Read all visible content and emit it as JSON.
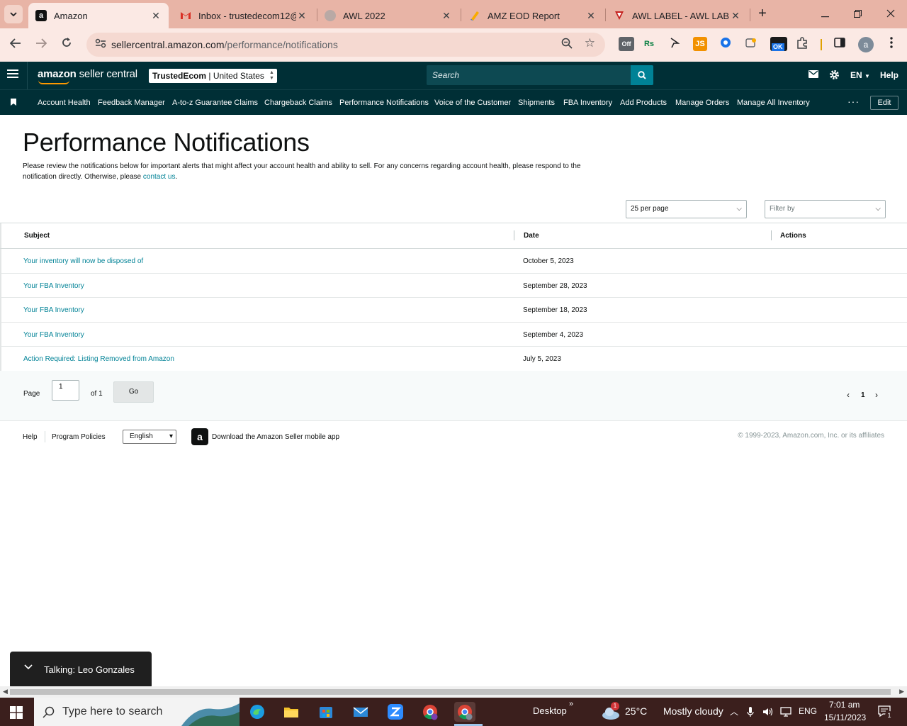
{
  "browser": {
    "tabs": [
      {
        "title": "Amazon",
        "active": true,
        "favicon": "amazon-a-icon"
      },
      {
        "title": "Inbox - trustedecom12@",
        "active": false,
        "favicon": "gmail-icon"
      },
      {
        "title": "AWL 2022",
        "active": false,
        "favicon": "globe-icon"
      },
      {
        "title": "AMZ EOD Report",
        "active": false,
        "favicon": "sheets-icon"
      },
      {
        "title": "AWL LABEL - AWL LABEL",
        "active": false,
        "favicon": "awl-icon"
      }
    ],
    "url_host": "sellercentral.amazon.com",
    "url_path": "/performance/notifications",
    "profile_initial": "a",
    "ext_off_label": "Off",
    "ext_ok_label": "OK",
    "ext_rs_label": "Rs",
    "ext_js_label": "JS"
  },
  "header": {
    "logo_main": "amazon",
    "logo_sub": "seller central",
    "store_name": "TrustedEcom",
    "store_market": "United States",
    "search_placeholder": "Search",
    "lang": "EN",
    "help": "Help"
  },
  "nav": {
    "items": [
      "Account Health",
      "Feedback Manager",
      "A-to-z Guarantee Claims",
      "Chargeback Claims",
      "Performance Notifications",
      "Voice of the Customer",
      "Shipments",
      "FBA Inventory",
      "Add Products",
      "Manage Orders",
      "Manage All Inventory"
    ],
    "more": "···",
    "edit": "Edit"
  },
  "page": {
    "title": "Performance Notifications",
    "intro_text": "Please review the notifications below for important alerts that might affect your account health and ability to sell. For any concerns regarding account health, please respond to the notification directly. Otherwise, please ",
    "intro_link": "contact us",
    "intro_end": ".",
    "per_page": "25 per page",
    "filter_placeholder": "Filter by"
  },
  "table": {
    "headers": {
      "subject": "Subject",
      "date": "Date",
      "actions": "Actions"
    },
    "rows": [
      {
        "subject": "Your inventory will now be disposed of",
        "date": "October 5, 2023"
      },
      {
        "subject": "Your FBA Inventory",
        "date": "September 28, 2023"
      },
      {
        "subject": "Your FBA Inventory",
        "date": "September 18, 2023"
      },
      {
        "subject": "Your FBA Inventory",
        "date": "September 4, 2023"
      },
      {
        "subject": "Action Required: Listing Removed from Amazon",
        "date": "July 5, 2023"
      }
    ]
  },
  "pager": {
    "page_label": "Page",
    "current": "1",
    "of_label": "of 1",
    "go": "Go",
    "page_num": "1"
  },
  "footer": {
    "help": "Help",
    "policies": "Program Policies",
    "language": "English",
    "app_text": "Download the Amazon Seller mobile app",
    "copyright": "© 1999-2023, Amazon.com, Inc. or its affiliates"
  },
  "toast": {
    "text": "Talking: Leo Gonzales"
  },
  "taskbar": {
    "search_placeholder": "Type here to search",
    "desktop": "Desktop",
    "weather_temp": "25°C",
    "weather_desc": "Mostly cloudy",
    "weather_badge": "1",
    "lang": "ENG",
    "time": "7:01 am",
    "date": "15/11/2023",
    "notif_count": "1"
  }
}
